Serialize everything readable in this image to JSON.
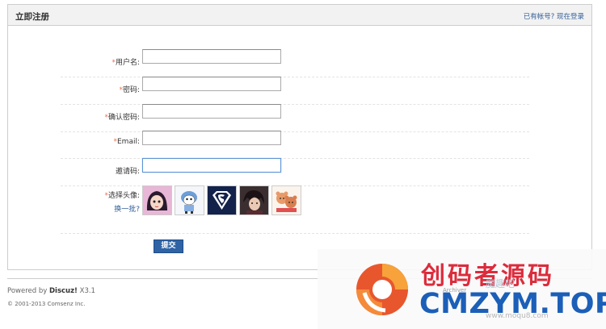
{
  "header": {
    "title": "立即注册",
    "has_account_text": "已有帐号?",
    "login_link": "现在登录"
  },
  "form": {
    "fields": [
      {
        "label": "用户名:",
        "required": true,
        "value": ""
      },
      {
        "label": "密码:",
        "required": true,
        "value": ""
      },
      {
        "label": "确认密码:",
        "required": true,
        "value": ""
      },
      {
        "label": "Email:",
        "required": true,
        "value": ""
      },
      {
        "label": "邀请码:",
        "required": false,
        "value": ""
      }
    ],
    "required_mark": "*",
    "avatar_label": "选择头像:",
    "avatar_more": "换一批?",
    "avatars": [
      "anime-girl-avatar",
      "blue-cartoon-boy-avatar",
      "superman-logo-avatar",
      "dark-anime-character-avatar",
      "cartoon-bears-avatar"
    ],
    "submit_label": "提交"
  },
  "footer": {
    "powered_prefix": "Powered by",
    "powered_brand": "Discuz!",
    "powered_version": "X3.1",
    "copyright": "© 2001-2013 Comsenz Inc.",
    "archiver": "Archiver"
  },
  "watermark": {
    "chinese": "创码者源码",
    "english": "CMZYM.TOP",
    "middle": "魔趣吧",
    "url": "www.moqu8.com"
  },
  "colors": {
    "accent_blue": "#2f63a6",
    "link_blue": "#335f99",
    "required_red": "#f26c4f"
  }
}
